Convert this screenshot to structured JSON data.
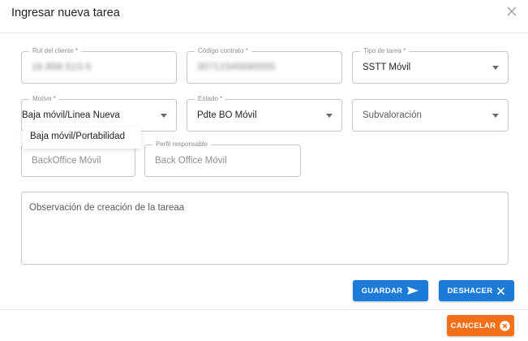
{
  "dialog": {
    "title": "Ingresar nueva tarea"
  },
  "fields": {
    "rut": {
      "label": "Rut del cliente *",
      "value": "16.858.513-5"
    },
    "codigo": {
      "label": "Código contrato *",
      "value": "30712345690000"
    },
    "tipo": {
      "label": "Tipo de tarea *",
      "value": "SSTT Móvil"
    },
    "motivo": {
      "label": "Motivo *",
      "value": "Baja móvil/Linea Nueva"
    },
    "estado": {
      "label": "Estado *",
      "value": "Pdte BO Móvil"
    },
    "subvaloracion": {
      "placeholder": "Subvaloración"
    },
    "backoffice": {
      "value": "BackOffice Móvil"
    },
    "perfil": {
      "label": "Perfil responsable",
      "value": "Back Office Móvil"
    },
    "observacion": {
      "placeholder": "Observación de creación de la tareaa"
    }
  },
  "motivo_menu": {
    "options": [
      "Baja móvil/Portabilidad"
    ]
  },
  "buttons": {
    "guardar": "GUARDAR",
    "deshacer": "DESHACER",
    "cancelar": "CANCELAR"
  },
  "colors": {
    "primary_blue": "#1c7bd8",
    "cancel_orange": "#f36f18"
  },
  "icons": {
    "close": "close-icon",
    "guardar": "send-icon",
    "deshacer": "x-icon",
    "cancelar": "x-circle-icon"
  }
}
